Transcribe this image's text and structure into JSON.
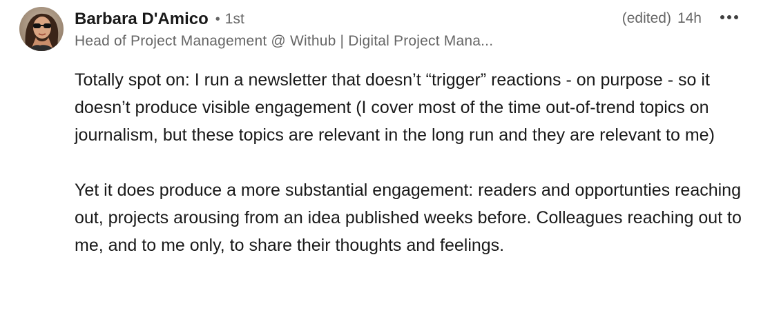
{
  "comment": {
    "author": {
      "name": "Barbara D'Amico",
      "separator": "•",
      "degree": "1st",
      "headline": "Head of Project Management @ Withub | Digital Project Mana..."
    },
    "meta": {
      "edited": "(edited)",
      "time": "14h"
    },
    "more_button": {
      "icon": "more-horizontal-icon"
    },
    "paragraphs": [
      "Totally spot on: I run a newsletter that doesn’t “trigger” reactions - on purpose - so it doesn’t produce visible engagement (I cover most of the time out-of-trend topics on journalism, but these topics are relevant in the long run and they are relevant to me)",
      "Yet it does produce a more substantial engagement: readers and opportunties reaching out, projects arousing from an idea published weeks before. Colleagues reaching out to me, and to me only, to share their thoughts and feelings."
    ]
  },
  "colors": {
    "primary_text": "#191919",
    "secondary_text": "#666666",
    "background": "#ffffff"
  }
}
